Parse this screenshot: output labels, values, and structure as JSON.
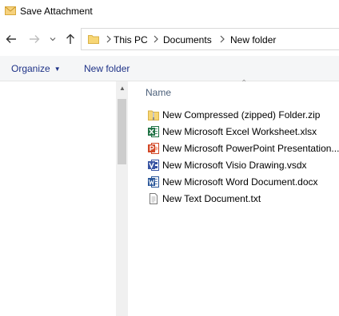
{
  "window": {
    "title": "Save Attachment"
  },
  "address": {
    "crumbs": [
      "This PC",
      "Documents",
      "New folder"
    ]
  },
  "toolbar": {
    "organize_label": "Organize",
    "new_folder_label": "New folder"
  },
  "filelist": {
    "column_name": "Name",
    "files": [
      {
        "name": "New Compressed (zipped) Folder.zip",
        "icon": "zip-folder-icon"
      },
      {
        "name": "New Microsoft Excel Worksheet.xlsx",
        "icon": "excel-icon"
      },
      {
        "name": "New Microsoft PowerPoint Presentation...",
        "icon": "powerpoint-icon"
      },
      {
        "name": "New Microsoft Visio Drawing.vsdx",
        "icon": "visio-icon"
      },
      {
        "name": "New Microsoft Word Document.docx",
        "icon": "word-icon"
      },
      {
        "name": "New Text Document.txt",
        "icon": "text-file-icon"
      }
    ]
  },
  "colors": {
    "command_text": "#1e3287",
    "command_bar_bg": "#f5f6f7",
    "header_text": "#4c607a",
    "folder_yellow": "#f7d675",
    "excel_green": "#1f7244",
    "powerpoint_red": "#d24726",
    "visio_blue": "#3955a3",
    "word_blue": "#2b579a"
  }
}
